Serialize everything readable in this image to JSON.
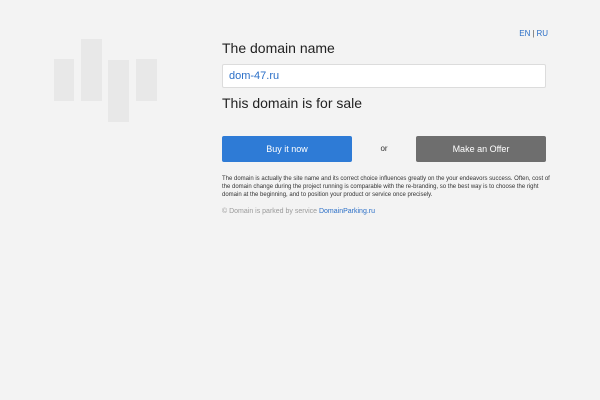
{
  "lang": {
    "en": "EN",
    "separator": "|",
    "ru": "RU"
  },
  "main": {
    "title": "The domain name",
    "domain": "dom-47.ru",
    "for_sale": "This domain is for sale",
    "buy_label": "Buy it now",
    "or_label": "or",
    "offer_label": "Make an Offer",
    "description": "The domain is actually the site name and its correct choice influences greatly on the your endeavors success. Often, cost of the domain change during the project running is comparable with the re-branding, so the best way is to choose the right domain at the beginning, and to position your product or service once precisely."
  },
  "footer": {
    "prefix": "© Domain is parked by service",
    "link": "DomainParking.ru"
  },
  "colors": {
    "background": "#f3f3f3",
    "buy_button": "#2e7bd6",
    "offer_button": "#6e6e6e",
    "link": "#2b6fc7"
  }
}
